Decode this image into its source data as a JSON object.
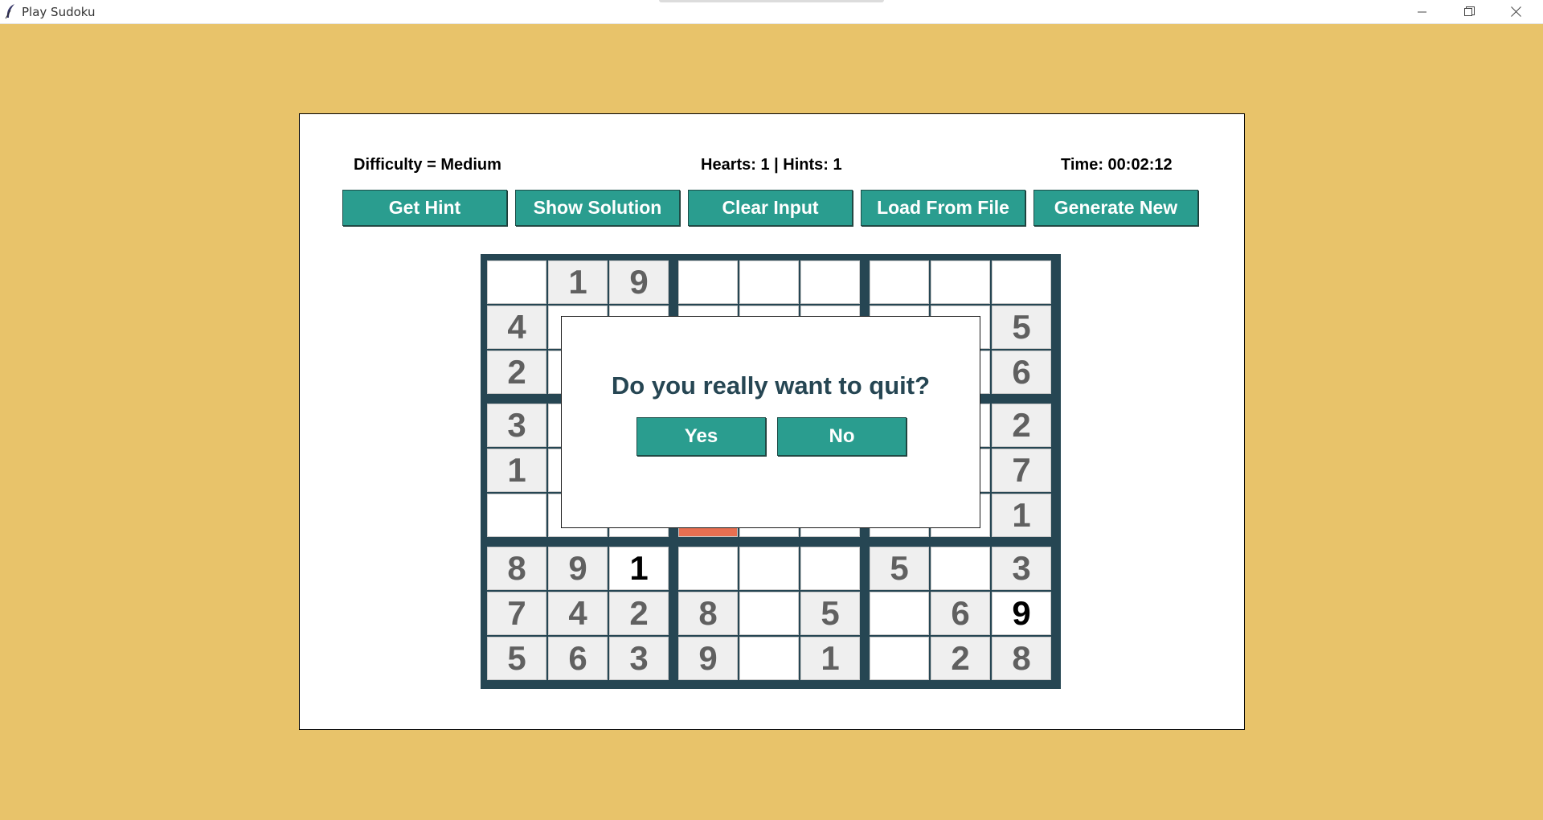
{
  "window": {
    "title": "Play Sudoku",
    "icon": "feather-icon",
    "controls": [
      "minimize-icon",
      "maximize-icon",
      "close-icon"
    ]
  },
  "status": {
    "difficulty": "Difficulty = Medium",
    "hearts_hints": "Hearts: 1 | Hints: 1",
    "time": "Time: 00:02:12"
  },
  "toolbar": {
    "hint": "Get Hint",
    "solution": "Show Solution",
    "clear": "Clear Input",
    "load": "Load From File",
    "generate": "Generate New"
  },
  "board": {
    "rows": [
      [
        {
          "v": "",
          "k": "empty"
        },
        {
          "v": "1",
          "k": "given"
        },
        {
          "v": "9",
          "k": "given"
        },
        {
          "v": "",
          "k": "empty"
        },
        {
          "v": "",
          "k": "empty"
        },
        {
          "v": "",
          "k": "empty"
        },
        {
          "v": "",
          "k": "empty"
        },
        {
          "v": "",
          "k": "empty"
        },
        {
          "v": "",
          "k": "empty"
        }
      ],
      [
        {
          "v": "4",
          "k": "given"
        },
        {
          "v": "",
          "k": "hidden"
        },
        {
          "v": "",
          "k": "hidden"
        },
        {
          "v": "",
          "k": "hidden"
        },
        {
          "v": "",
          "k": "hidden"
        },
        {
          "v": "",
          "k": "hidden"
        },
        {
          "v": "",
          "k": "hidden"
        },
        {
          "v": "",
          "k": "hidden"
        },
        {
          "v": "5",
          "k": "given"
        }
      ],
      [
        {
          "v": "2",
          "k": "given"
        },
        {
          "v": "",
          "k": "hidden"
        },
        {
          "v": "",
          "k": "hidden"
        },
        {
          "v": "",
          "k": "hidden"
        },
        {
          "v": "",
          "k": "hidden"
        },
        {
          "v": "",
          "k": "hidden"
        },
        {
          "v": "",
          "k": "hidden"
        },
        {
          "v": "",
          "k": "hidden"
        },
        {
          "v": "6",
          "k": "given"
        }
      ],
      [
        {
          "v": "3",
          "k": "given"
        },
        {
          "v": "",
          "k": "hidden"
        },
        {
          "v": "",
          "k": "hidden"
        },
        {
          "v": "",
          "k": "hidden"
        },
        {
          "v": "",
          "k": "hidden"
        },
        {
          "v": "",
          "k": "hidden"
        },
        {
          "v": "",
          "k": "hidden"
        },
        {
          "v": "",
          "k": "hidden"
        },
        {
          "v": "2",
          "k": "given"
        }
      ],
      [
        {
          "v": "1",
          "k": "given"
        },
        {
          "v": "",
          "k": "hidden"
        },
        {
          "v": "",
          "k": "hidden"
        },
        {
          "v": "",
          "k": "hidden"
        },
        {
          "v": "",
          "k": "hidden"
        },
        {
          "v": "",
          "k": "hidden"
        },
        {
          "v": "",
          "k": "hidden"
        },
        {
          "v": "",
          "k": "hidden"
        },
        {
          "v": "7",
          "k": "given"
        }
      ],
      [
        {
          "v": "",
          "k": "empty"
        },
        {
          "v": "",
          "k": "hidden"
        },
        {
          "v": "",
          "k": "hidden"
        },
        {
          "v": "",
          "k": "selected"
        },
        {
          "v": "",
          "k": "hidden"
        },
        {
          "v": "",
          "k": "hidden"
        },
        {
          "v": "",
          "k": "hidden"
        },
        {
          "v": "",
          "k": "hidden"
        },
        {
          "v": "1",
          "k": "given"
        }
      ],
      [
        {
          "v": "8",
          "k": "given"
        },
        {
          "v": "9",
          "k": "given"
        },
        {
          "v": "1",
          "k": "user"
        },
        {
          "v": "",
          "k": "empty"
        },
        {
          "v": "",
          "k": "empty"
        },
        {
          "v": "",
          "k": "empty"
        },
        {
          "v": "5",
          "k": "given"
        },
        {
          "v": "",
          "k": "empty"
        },
        {
          "v": "3",
          "k": "given"
        }
      ],
      [
        {
          "v": "7",
          "k": "given"
        },
        {
          "v": "4",
          "k": "given"
        },
        {
          "v": "2",
          "k": "given"
        },
        {
          "v": "8",
          "k": "given"
        },
        {
          "v": "",
          "k": "empty"
        },
        {
          "v": "5",
          "k": "given"
        },
        {
          "v": "",
          "k": "empty"
        },
        {
          "v": "6",
          "k": "given"
        },
        {
          "v": "9",
          "k": "user"
        }
      ],
      [
        {
          "v": "5",
          "k": "given"
        },
        {
          "v": "6",
          "k": "given"
        },
        {
          "v": "3",
          "k": "given"
        },
        {
          "v": "9",
          "k": "given"
        },
        {
          "v": "",
          "k": "empty"
        },
        {
          "v": "1",
          "k": "given"
        },
        {
          "v": "",
          "k": "empty"
        },
        {
          "v": "2",
          "k": "given"
        },
        {
          "v": "8",
          "k": "given"
        }
      ]
    ]
  },
  "dialog": {
    "message": "Do you really want to quit?",
    "yes": "Yes",
    "no": "No"
  },
  "colors": {
    "background": "#e8c36a",
    "accent": "#2a9d8f",
    "grid": "#264653",
    "selected": "#e76f51"
  }
}
